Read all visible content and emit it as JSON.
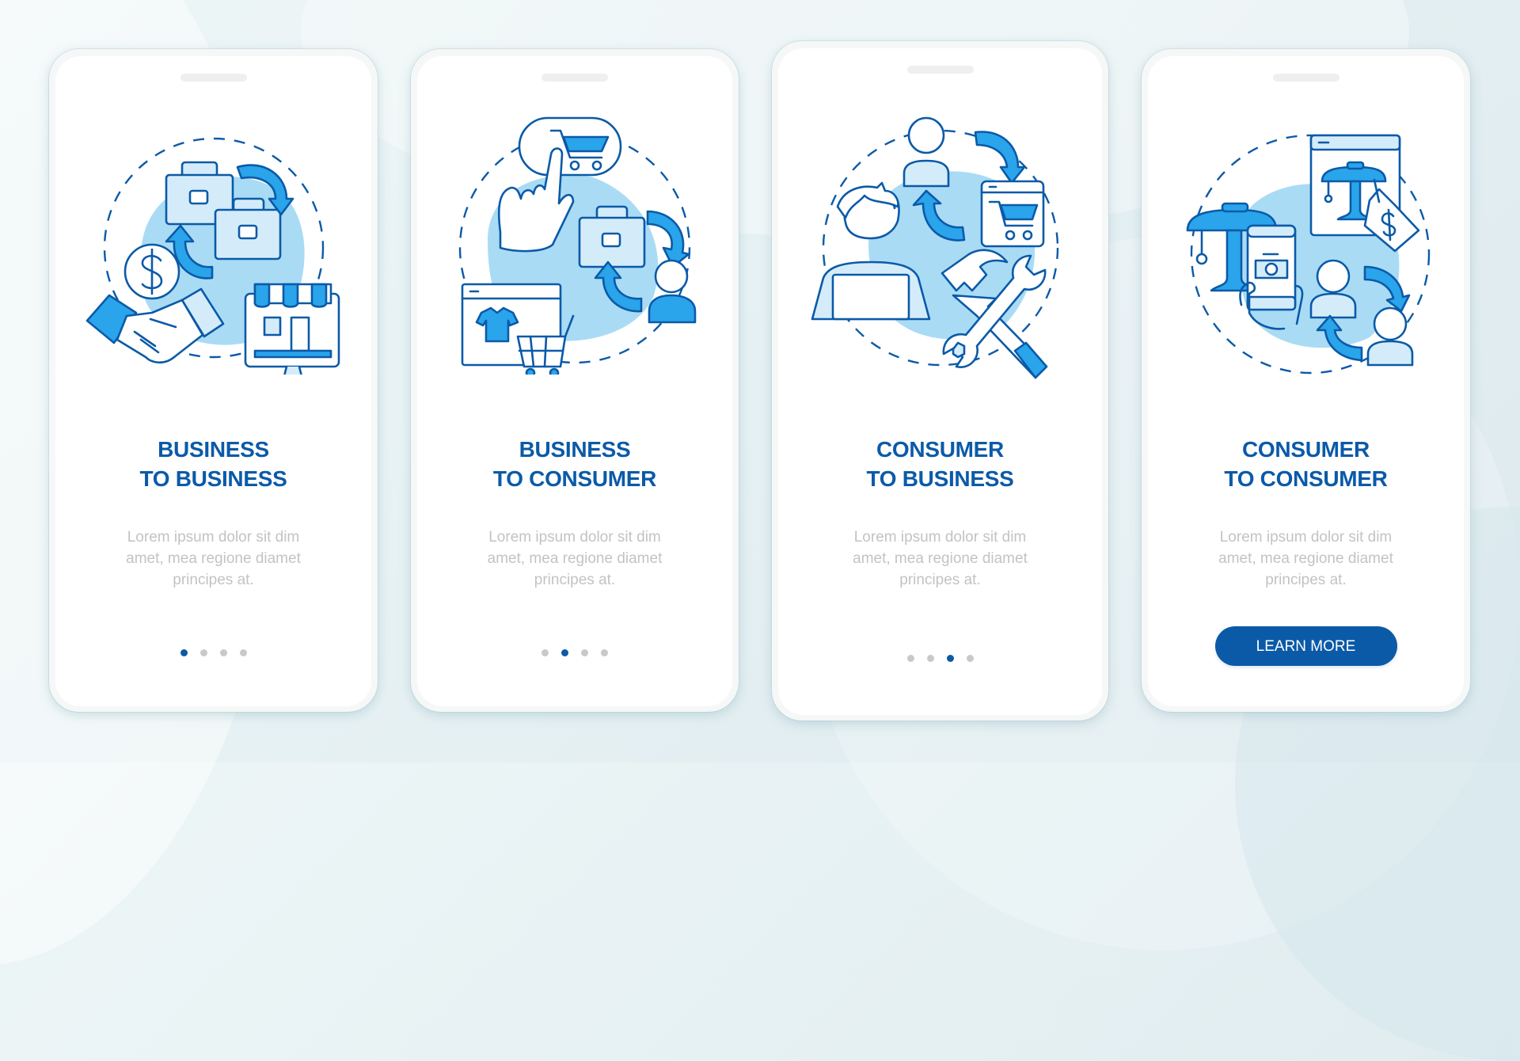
{
  "colors": {
    "accent": "#0b5aa8",
    "icon_fill": "#2aa4ea",
    "icon_light": "#d4ecfa",
    "blob": "#a9dbf5",
    "body_text": "#c3c3c3",
    "dot_inactive": "#c9c9c9"
  },
  "screens": [
    {
      "title_line1": "BUSINESS",
      "title_line2": "TO BUSINESS",
      "body_lines": [
        "Lorem ipsum dolor sit dim",
        "amet, mea regione diamet",
        "principes at."
      ],
      "illustration": [
        "briefcase-icon",
        "briefcase-icon",
        "exchange-arrows-icon",
        "dollar-coin-icon",
        "handshake-icon",
        "online-store-icon"
      ],
      "pagination": {
        "total": 4,
        "active": 1
      }
    },
    {
      "title_line1": "BUSINESS",
      "title_line2": "TO CONSUMER",
      "body_lines": [
        "Lorem ipsum dolor sit dim",
        "amet, mea regione diamet",
        "principes at."
      ],
      "illustration": [
        "tap-cart-bubble-icon",
        "pointing-hand-icon",
        "briefcase-icon",
        "exchange-arrows-icon",
        "customer-icon",
        "shop-window-icon",
        "tshirt-icon",
        "shopping-cart-icon"
      ],
      "pagination": {
        "total": 4,
        "active": 2
      }
    },
    {
      "title_line1": "CONSUMER",
      "title_line2": "TO BUSINESS",
      "body_lines": [
        "Lorem ipsum dolor sit dim",
        "amet, mea regione diamet",
        "principes at."
      ],
      "illustration": [
        "user-icon",
        "exchange-arrows-icon",
        "web-cart-icon",
        "freelancer-laptop-icon",
        "hammer-icon",
        "wrench-icon"
      ],
      "pagination": {
        "total": 4,
        "active": 3
      }
    },
    {
      "title_line1": "CONSUMER",
      "title_line2": "TO CONSUMER",
      "body_lines": [
        "Lorem ipsum dolor sit dim",
        "amet, mea regione diamet",
        "principes at."
      ],
      "illustration": [
        "lamp-listing-icon",
        "price-tag-icon",
        "lamp-icon",
        "phone-photo-icon",
        "user-icon",
        "user-icon",
        "exchange-arrows-icon"
      ],
      "button_label": "LEARN MORE"
    }
  ]
}
